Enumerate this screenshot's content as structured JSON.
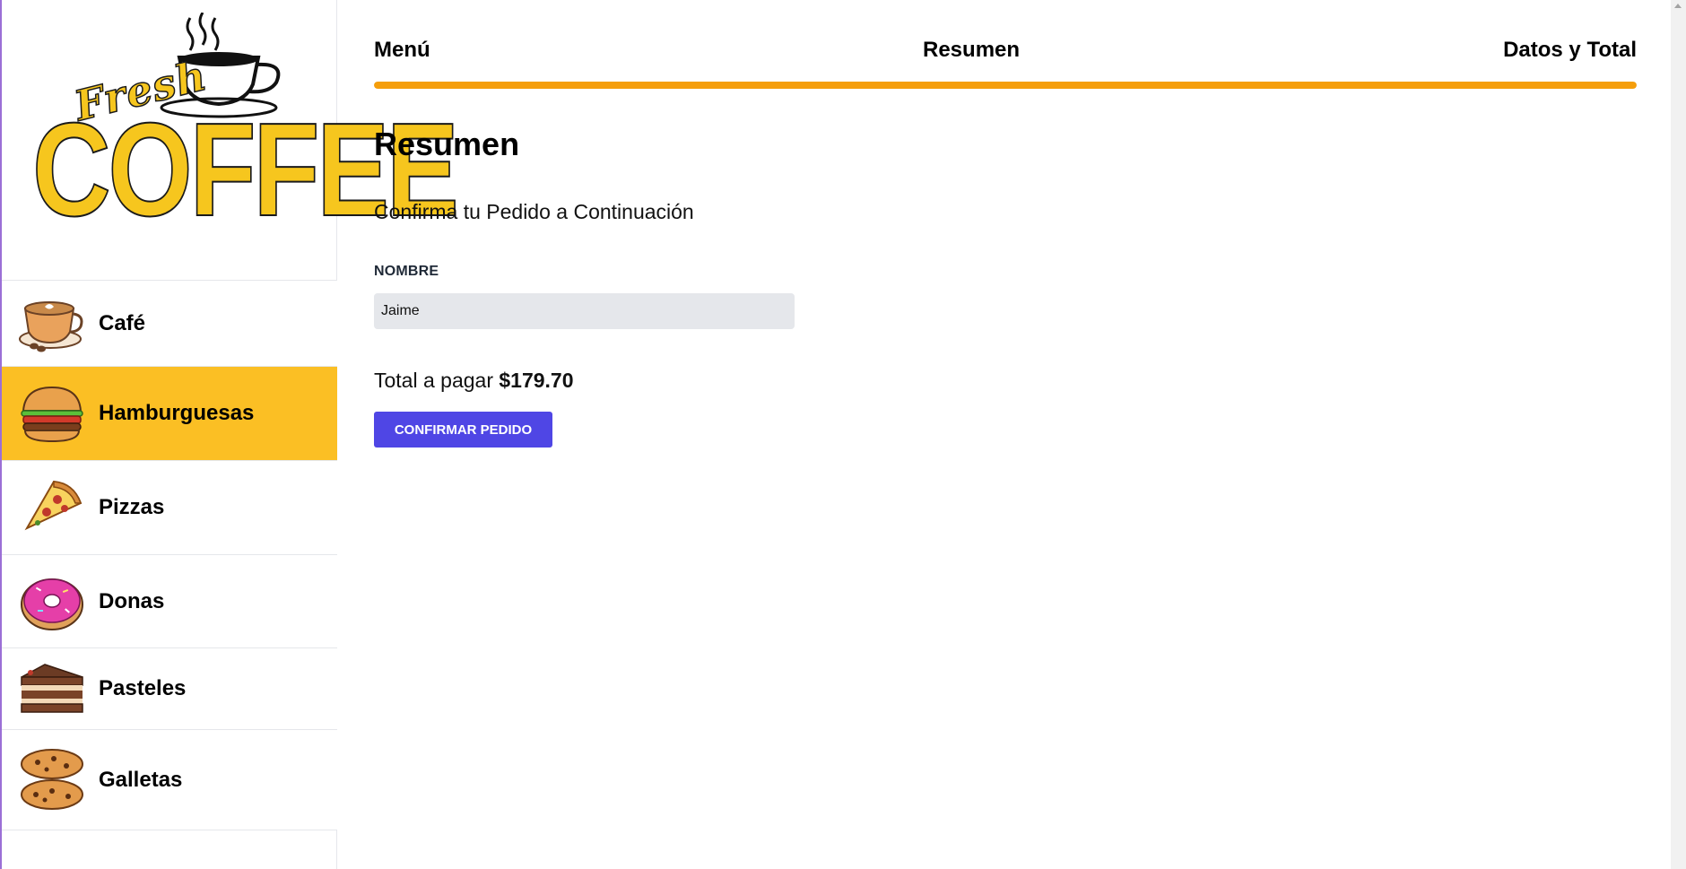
{
  "brand": {
    "logo_top": "Fresh",
    "logo_main": "COFFEE"
  },
  "sidebar": {
    "items": [
      {
        "label": "Café",
        "icon": "coffee-cup-icon",
        "active": false
      },
      {
        "label": "Hamburguesas",
        "icon": "burger-icon",
        "active": true
      },
      {
        "label": "Pizzas",
        "icon": "pizza-slice-icon",
        "active": false
      },
      {
        "label": "Donas",
        "icon": "donut-icon",
        "active": false
      },
      {
        "label": "Pasteles",
        "icon": "cake-slice-icon",
        "active": false
      },
      {
        "label": "Galletas",
        "icon": "cookies-icon",
        "active": false
      }
    ]
  },
  "steps": {
    "items": [
      "Menú",
      "Resumen",
      "Datos y Total"
    ],
    "progress_fraction": 1.0
  },
  "summary": {
    "title": "Resumen",
    "subtitle": "Confirma tu Pedido a Continuación",
    "name_label": "Nombre",
    "name_value": "Jaime",
    "total_label": "Total a pagar",
    "total_amount": "$179.70",
    "confirm_label": "Confirmar Pedido"
  },
  "colors": {
    "active_category": "#fbbf24",
    "progress": "#f59e0b",
    "primary_button": "#4f46e5",
    "logo_yellow": "#f6c61e"
  }
}
